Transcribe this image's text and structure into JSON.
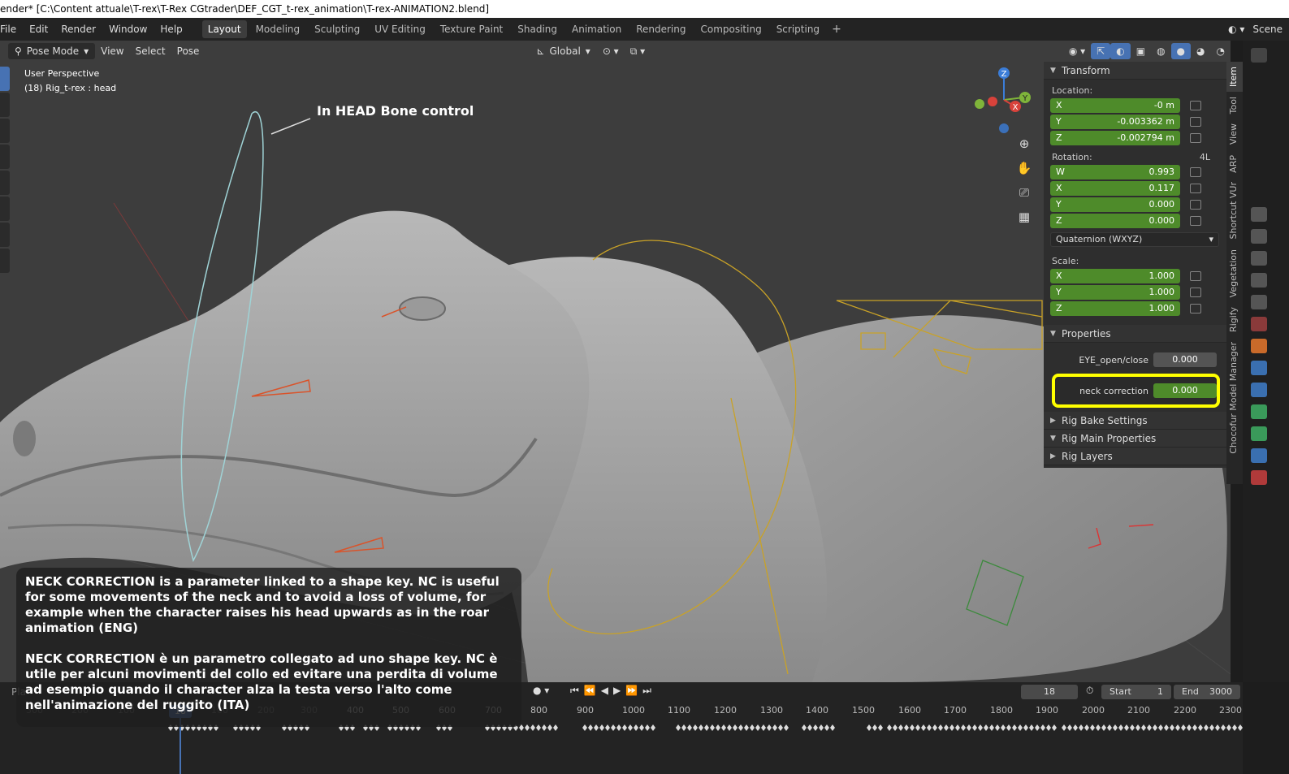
{
  "window": {
    "title": "ender* [C:\\Content attuale\\T-rex\\T-Rex CGtrader\\DEF_CGT_t-rex_animation\\T-rex-ANIMATION2.blend]"
  },
  "menu": [
    "File",
    "Edit",
    "Render",
    "Window",
    "Help"
  ],
  "workspaces": [
    {
      "label": "Layout",
      "active": true
    },
    {
      "label": "Modeling"
    },
    {
      "label": "Sculpting"
    },
    {
      "label": "UV Editing"
    },
    {
      "label": "Texture Paint"
    },
    {
      "label": "Shading"
    },
    {
      "label": "Animation"
    },
    {
      "label": "Rendering"
    },
    {
      "label": "Compositing"
    },
    {
      "label": "Scripting"
    }
  ],
  "scene": {
    "label": "Scene"
  },
  "viewport_header": {
    "mode": "Pose Mode",
    "menus": [
      "View",
      "Select",
      "Pose"
    ],
    "orientation": "Global"
  },
  "viewport_info": {
    "line1": "User Perspective",
    "line2": "(18) Rig_t-rex : head"
  },
  "annotation": "In HEAD Bone control",
  "gizmo": {
    "z": "Z",
    "y": "Y",
    "x": "X"
  },
  "transform": {
    "title": "Transform",
    "location_label": "Location:",
    "location": [
      {
        "axis": "X",
        "value": "-0 m"
      },
      {
        "axis": "Y",
        "value": "-0.003362 m"
      },
      {
        "axis": "Z",
        "value": "-0.002794 m"
      }
    ],
    "rotation_label": "Rotation:",
    "rotation_mode_short": "4L",
    "rotation": [
      {
        "axis": "W",
        "value": "0.993"
      },
      {
        "axis": "X",
        "value": "0.117"
      },
      {
        "axis": "Y",
        "value": "0.000"
      },
      {
        "axis": "Z",
        "value": "0.000"
      }
    ],
    "rotation_mode": "Quaternion (WXYZ)",
    "scale_label": "Scale:",
    "scale": [
      {
        "axis": "X",
        "value": "1.000"
      },
      {
        "axis": "Y",
        "value": "1.000"
      },
      {
        "axis": "Z",
        "value": "1.000"
      }
    ]
  },
  "properties": {
    "title": "Properties",
    "items": [
      {
        "label": "EYE_open/close",
        "value": "0.000"
      },
      {
        "label": "neck correction",
        "value": "0.000"
      }
    ]
  },
  "collapsed_panels": [
    "Rig Bake Settings",
    "Rig Main Properties",
    "Rig Layers"
  ],
  "side_tabs": [
    "Item",
    "Tool",
    "View",
    "ARP",
    "Shortcut VUr",
    "Vegetation",
    "Rigify",
    "Chocofur Model Manager"
  ],
  "timeline": {
    "current_frame": "18",
    "start_label": "Start",
    "start": "1",
    "end_label": "End",
    "end": "3000",
    "play_label": "Pla",
    "ruler": [
      "300",
      "200",
      "100",
      "18",
      "100",
      "200",
      "300",
      "400",
      "500",
      "600",
      "700",
      "800",
      "900",
      "1000",
      "1100",
      "1200",
      "1300",
      "1400",
      "1500",
      "1600",
      "1700",
      "1800",
      "1900",
      "2000",
      "2100",
      "2200",
      "2300"
    ]
  },
  "caption": {
    "eng": "NECK CORRECTION is a parameter linked to a shape key. NC is useful for some movements of the neck and to avoid a loss of volume, for example when the character raises his head upwards as in the roar animation (ENG)",
    "ita": "NECK CORRECTION è un parametro collegato ad uno shape key. NC è utile per alcuni movimenti del collo ed evitare una perdita di volume ad esempio quando il character alza la testa verso l'alto come nell'animazione del ruggito (ITA)"
  },
  "colors": {
    "field_green": "#4e8b2a",
    "highlight_yellow": "#ffff00",
    "accent_blue": "#4772b3",
    "viewport_bg": "#3d3d3d",
    "rig_yellow": "#c9a227"
  }
}
